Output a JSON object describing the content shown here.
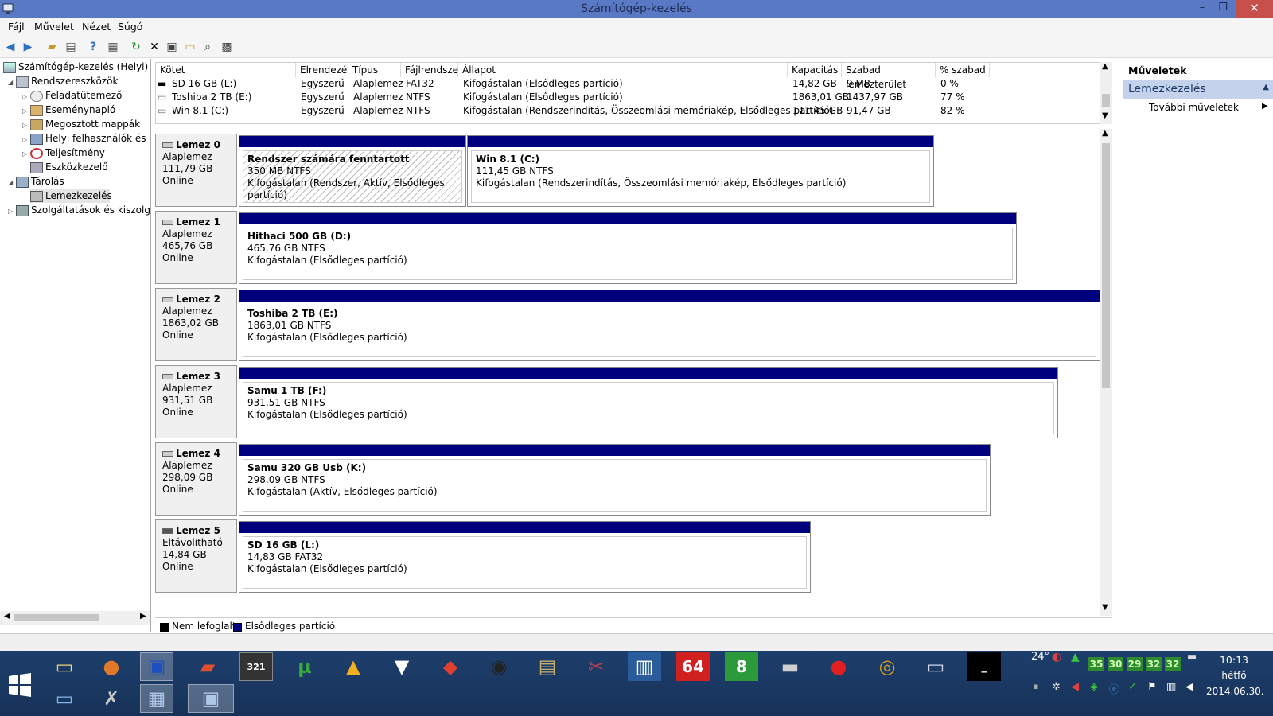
{
  "window": {
    "title": "Számítógép-kezelés",
    "min": "–",
    "max": "❐",
    "close": "✕"
  },
  "menu": [
    "Fájl",
    "Művelet",
    "Nézet",
    "Súgó"
  ],
  "tree": {
    "root": "Számítógép-kezelés (Helyi)",
    "items": [
      {
        "label": "Rendszereszközök"
      },
      {
        "label": "Feladatütemező"
      },
      {
        "label": "Eseménynapló"
      },
      {
        "label": "Megosztott mappák"
      },
      {
        "label": "Helyi felhasználók és cs"
      },
      {
        "label": "Teljesítmény"
      },
      {
        "label": "Eszközkezelő"
      },
      {
        "label": "Tárolás"
      },
      {
        "label": "Lemezkezelés"
      },
      {
        "label": "Szolgáltatások és kiszolgáló"
      }
    ]
  },
  "volumes": {
    "headers": [
      "Kötet",
      "Elrendezés",
      "Típus",
      "Fájlrendszer",
      "Állapot",
      "Kapacitás",
      "Szabad lemezterület",
      "% szabad"
    ],
    "rows": [
      [
        "SD 16 GB (L:)",
        "Egyszerű",
        "Alaplemez",
        "FAT32",
        "Kifogástalan (Elsődleges partíció)",
        "14,82 GB",
        "9 MB",
        "0 %"
      ],
      [
        "Toshiba 2 TB (E:)",
        "Egyszerű",
        "Alaplemez",
        "NTFS",
        "Kifogástalan (Elsődleges partíció)",
        "1863,01 GB",
        "1437,97 GB",
        "77 %"
      ],
      [
        "Win 8.1 (C:)",
        "Egyszerű",
        "Alaplemez",
        "NTFS",
        "Kifogástalan (Rendszerindítás, Összeomlási memóriakép, Elsődleges partíció)",
        "111,45 GB",
        "91,47 GB",
        "82 %"
      ]
    ]
  },
  "disks": [
    {
      "name": "Lemez 0",
      "type": "Alaplemez",
      "size": "111,79 GB",
      "status": "Online",
      "partitions": [
        {
          "title": "Rendszer számára fenntartott",
          "size": "350 MB NTFS",
          "status": "Kifogástalan (Rendszer, Aktív, Elsődleges partíció)"
        },
        {
          "title": "Win 8.1  (C:)",
          "size": "111,45 GB NTFS",
          "status": "Kifogástalan (Rendszerindítás, Összeomlási memóriakép, Elsődleges partíció)"
        }
      ]
    },
    {
      "name": "Lemez 1",
      "type": "Alaplemez",
      "size": "465,76 GB",
      "status": "Online",
      "partitions": [
        {
          "title": "Hithaci 500 GB  (D:)",
          "size": "465,76 GB NTFS",
          "status": "Kifogástalan (Elsődleges partíció)"
        }
      ]
    },
    {
      "name": "Lemez 2",
      "type": "Alaplemez",
      "size": "1863,02 GB",
      "status": "Online",
      "partitions": [
        {
          "title": "Toshiba 2 TB  (E:)",
          "size": "1863,01 GB NTFS",
          "status": "Kifogástalan (Elsődleges partíció)"
        }
      ]
    },
    {
      "name": "Lemez 3",
      "type": "Alaplemez",
      "size": "931,51 GB",
      "status": "Online",
      "partitions": [
        {
          "title": "Samu 1 TB  (F:)",
          "size": "931,51 GB NTFS",
          "status": "Kifogástalan (Elsődleges partíció)"
        }
      ]
    },
    {
      "name": "Lemez 4",
      "type": "Alaplemez",
      "size": "298,09 GB",
      "status": "Online",
      "partitions": [
        {
          "title": "Samu 320 GB Usb  (K:)",
          "size": "298,09 GB NTFS",
          "status": "Kifogástalan (Aktív, Elsődleges partíció)"
        }
      ]
    },
    {
      "name": "Lemez 5",
      "type": "Eltávolítható",
      "size": "14,84 GB",
      "status": "Online",
      "partitions": [
        {
          "title": "SD 16 GB  (L:)",
          "size": "14,83 GB FAT32",
          "status": "Kifogástalan (Elsődleges partíció)"
        }
      ]
    }
  ],
  "legend": [
    "Nem lefoglalt",
    "Elsődleges partíció"
  ],
  "actions": {
    "header": "Műveletek",
    "section": "Lemezkezelés",
    "item": "További műveletek"
  },
  "taskbar": {
    "badge_321": "321",
    "badge_64": "64",
    "badge_8": "8",
    "tray_temp": "24°",
    "tray_nums": [
      "35",
      "30",
      "29",
      "32",
      "32"
    ],
    "time": "10:13",
    "day": "hétfő",
    "date": "2014.06.30."
  },
  "colors": {
    "primary_partition": "#00007f",
    "title_bar": "#5a79c4",
    "actions_section": "#c5d2ec"
  }
}
